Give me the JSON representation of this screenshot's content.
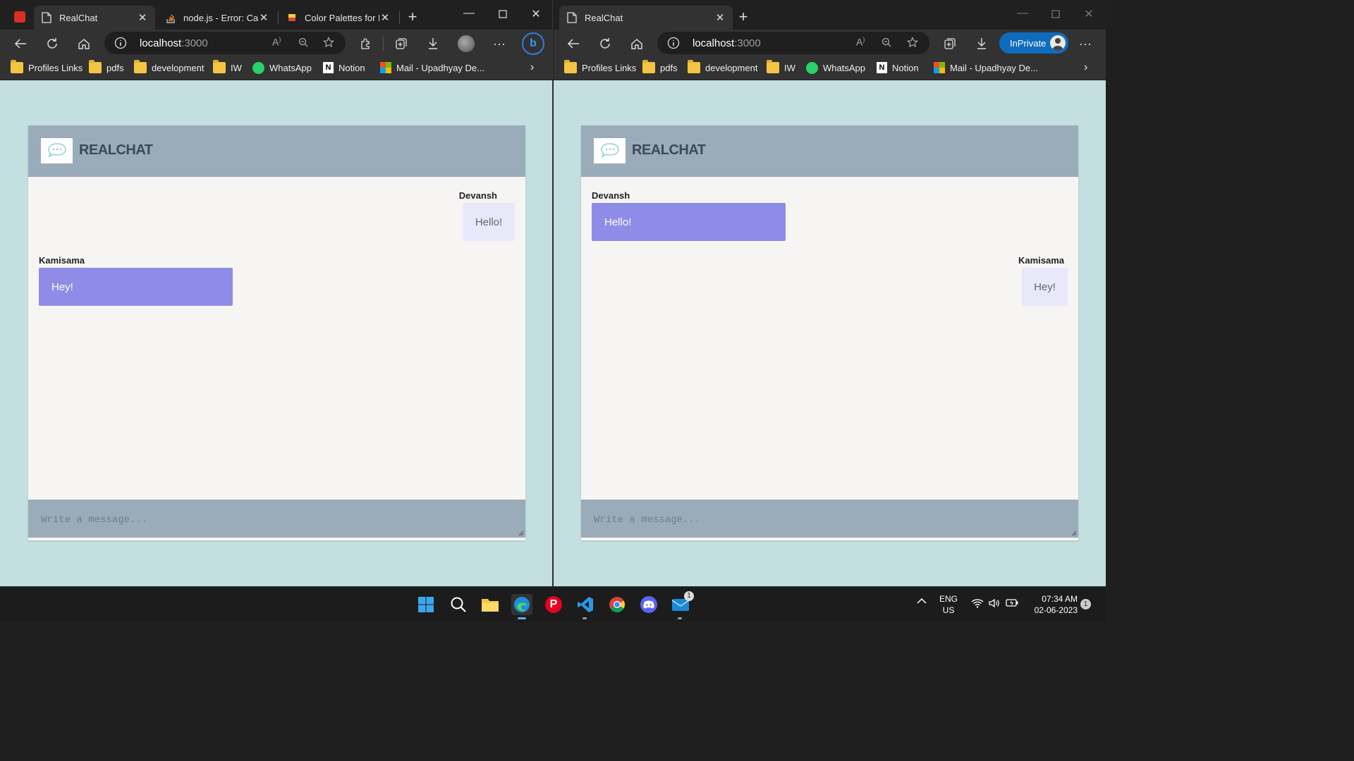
{
  "left_window": {
    "tabs": [
      {
        "title": "RealChat",
        "icon": "document-icon"
      },
      {
        "title": "node.js - Error: Can",
        "icon": "stackoverflow-icon"
      },
      {
        "title": "Color Palettes for D",
        "icon": "palette-icon"
      }
    ],
    "url_host": "localhost",
    "url_port": ":3000"
  },
  "right_window": {
    "tabs": [
      {
        "title": "RealChat",
        "icon": "document-icon"
      }
    ],
    "url_host": "localhost",
    "url_port": ":3000",
    "inprivate_label": "InPrivate"
  },
  "bookmarks": [
    {
      "label": "Profiles Links",
      "icon": "folder-icon"
    },
    {
      "label": "pdfs",
      "icon": "folder-icon"
    },
    {
      "label": "development",
      "icon": "folder-icon"
    },
    {
      "label": "IW",
      "icon": "folder-icon"
    },
    {
      "label": "WhatsApp",
      "icon": "whatsapp-icon"
    },
    {
      "label": "Notion",
      "icon": "notion-icon"
    },
    {
      "label": "Mail - Upadhyay De...",
      "icon": "microsoft-icon"
    }
  ],
  "app": {
    "brand": "REALCHAT",
    "composer_placeholder": "Write a message...",
    "colors": {
      "page_bg": "#c4dfe0",
      "header_bg": "#9aabba",
      "own_bubble": "#8f8ce8",
      "other_bubble": "#e9e8fb"
    }
  },
  "chat_left": {
    "messages": [
      {
        "sender": "Devansh",
        "text": "Hello!",
        "side": "right"
      },
      {
        "sender": "Kamisama",
        "text": "Hey!",
        "side": "left"
      }
    ]
  },
  "chat_right": {
    "messages": [
      {
        "sender": "Devansh",
        "text": "Hello!",
        "side": "left"
      },
      {
        "sender": "Kamisama",
        "text": "Hey!",
        "side": "right"
      }
    ]
  },
  "taskbar": {
    "language": "ENG",
    "region": "US",
    "time": "07:34 AM",
    "date": "02-06-2023",
    "mail_badge": "1",
    "notification_count": "1"
  }
}
